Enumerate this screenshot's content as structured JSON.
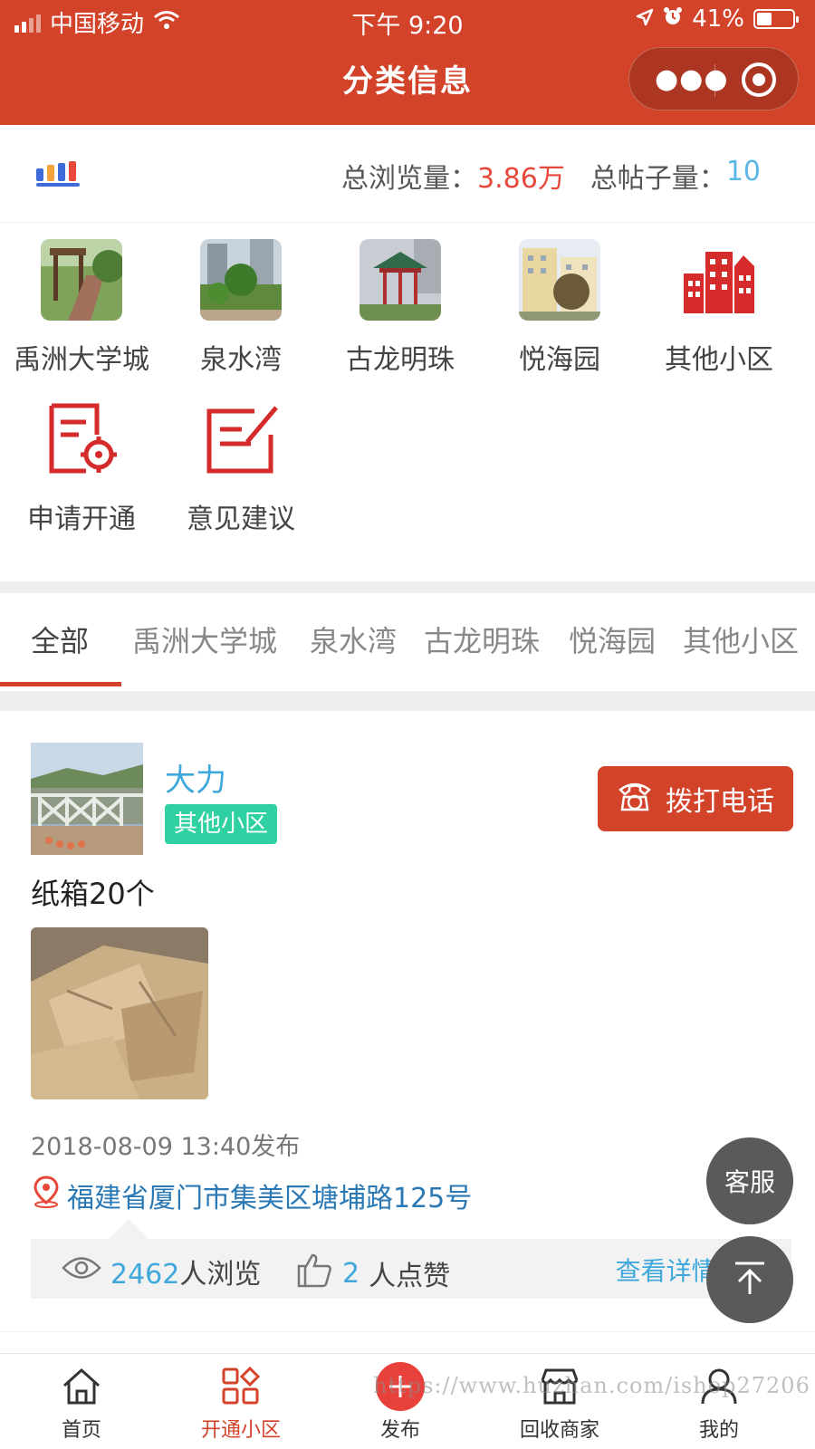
{
  "status_bar": {
    "carrier": "中国移动",
    "time": "下午 9:20",
    "battery": "41%"
  },
  "header": {
    "title": "分类信息",
    "more_icon": "more-dots-icon",
    "target_icon": "target-icon"
  },
  "stats": {
    "views_label": "总浏览量：",
    "views_value": "3.86万",
    "posts_label": "总帖子量：",
    "posts_value": "10"
  },
  "categories": [
    {
      "label": "禹洲大学城",
      "image": "garden-walkway-photo"
    },
    {
      "label": "泉水湾",
      "image": "residential-park-photo"
    },
    {
      "label": "古龙明珠",
      "image": "pavilion-photo"
    },
    {
      "label": "悦海园",
      "image": "apartment-building-photo"
    },
    {
      "label": "其他小区",
      "icon": "buildings-icon"
    },
    {
      "label": "申请开通",
      "icon": "document-settings-icon"
    },
    {
      "label": "意见建议",
      "icon": "edit-note-icon"
    }
  ],
  "tabs": [
    "全部",
    "禹洲大学城",
    "泉水湾",
    "古龙明珠",
    "悦海园",
    "其他小区"
  ],
  "post": {
    "username": "大力",
    "badge": "其他小区",
    "call_label": "拨打电话",
    "text": "纸箱20个",
    "time": "2018-08-09 13:40发布",
    "location": "福建省厦门市集美区塘埔路125号",
    "views_count": "2462",
    "views_unit": "人浏览",
    "likes_count": "2",
    "likes_unit": "人点赞",
    "details_label": "查看详情 >"
  },
  "floating": {
    "service_label": "客服",
    "top_icon": "arrow-up-icon"
  },
  "tabbar": [
    {
      "label": "首页",
      "icon": "home-icon"
    },
    {
      "label": "开通小区",
      "icon": "grid-icon"
    },
    {
      "label": "发布",
      "icon": "plus-icon"
    },
    {
      "label": "回收商家",
      "icon": "shop-icon"
    },
    {
      "label": "我的",
      "icon": "person-icon"
    }
  ],
  "watermark": "https://www.huzhan.com/ishop27206",
  "colors": {
    "brand": "#d2432a",
    "accent_blue": "#3ea8dc",
    "badge_green": "#2fd1a3",
    "views_red": "#e7483a"
  }
}
